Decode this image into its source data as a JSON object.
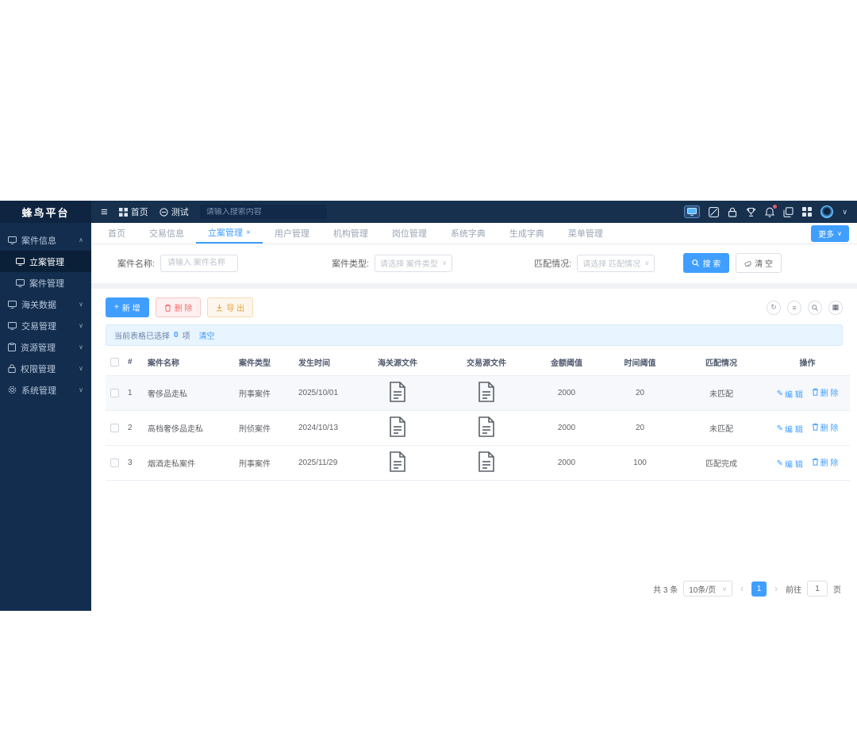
{
  "brand": {
    "title": "蜂鸟平台"
  },
  "topbar": {
    "home_label": "首页",
    "test_label": "测试",
    "search_placeholder": "请输入搜索内容"
  },
  "sidebar": {
    "items": [
      {
        "label": "案件信息"
      },
      {
        "label": "立案管理"
      },
      {
        "label": "案件管理"
      },
      {
        "label": "海关数据"
      },
      {
        "label": "交易管理"
      },
      {
        "label": "资源管理"
      },
      {
        "label": "权限管理"
      },
      {
        "label": "系统管理"
      }
    ]
  },
  "tabs": {
    "items": [
      "首页",
      "交易信息",
      "立案管理",
      "用户管理",
      "机构管理",
      "岗位管理",
      "系统字典",
      "生成字典",
      "菜单管理"
    ],
    "active": "立案管理",
    "more_label": "更多"
  },
  "filters": {
    "name_label": "案件名称:",
    "name_placeholder": "请输入 案件名称",
    "type_label": "案件类型:",
    "type_placeholder": "请选择 案件类型",
    "match_label": "匹配情况:",
    "match_placeholder": "请选择 匹配情况",
    "search_label": "搜 索",
    "clear_label": "清 空"
  },
  "toolbar": {
    "add_label": "新 增",
    "delete_label": "删 除",
    "export_label": "导 出"
  },
  "selection_bar": {
    "prefix": "当前表格已选择",
    "count": "0",
    "suffix": "项",
    "clear_label": "清空"
  },
  "table": {
    "headers": [
      "#",
      "案件名称",
      "案件类型",
      "发生时间",
      "海关源文件",
      "交易源文件",
      "金额阈值",
      "时间阈值",
      "匹配情况",
      "操作"
    ],
    "edit_label": "编 辑",
    "delete_label": "删 除",
    "rows": [
      {
        "index": "1",
        "name": "奢侈品走私",
        "type": "刑事案件",
        "date": "2025/10/01",
        "amount": "2000",
        "time": "20",
        "match": "未匹配"
      },
      {
        "index": "2",
        "name": "高档奢侈品走私",
        "type": "刑侦案件",
        "date": "2024/10/13",
        "amount": "2000",
        "time": "20",
        "match": "未匹配"
      },
      {
        "index": "3",
        "name": "烟酒走私案件",
        "type": "刑事案件",
        "date": "2025/11/29",
        "amount": "2000",
        "time": "100",
        "match": "匹配完成"
      }
    ]
  },
  "pagination": {
    "total": "共 3 条",
    "page_size": "10条/页",
    "current_page": "1",
    "goto_prefix": "前往",
    "goto_value": "1",
    "goto_suffix": "页"
  },
  "colors": {
    "accent": "#409eff",
    "danger": "#f56c6c",
    "warning": "#e6a23c",
    "topbar_bg": "#16304e",
    "sidebar_bg": "#132d4e",
    "selection_bg": "#e8f4ff"
  }
}
